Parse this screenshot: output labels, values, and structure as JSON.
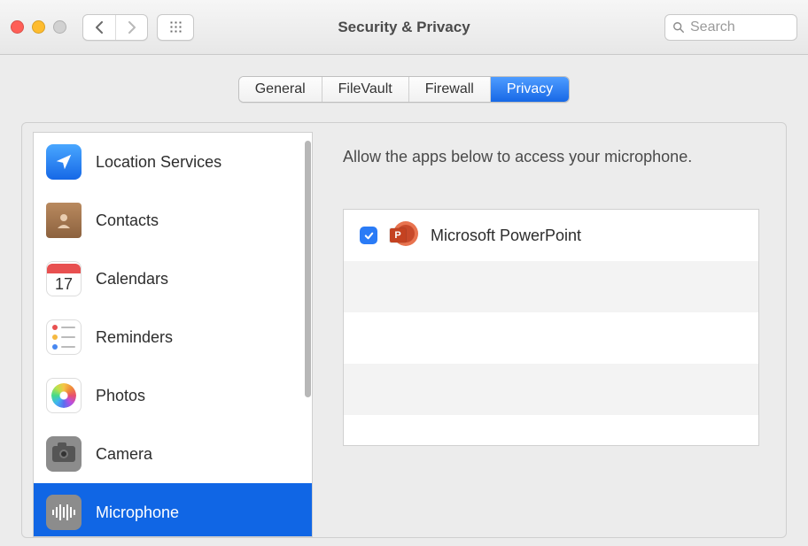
{
  "window": {
    "title": "Security & Privacy"
  },
  "search": {
    "placeholder": "Search"
  },
  "tabs": [
    {
      "label": "General",
      "selected": false
    },
    {
      "label": "FileVault",
      "selected": false
    },
    {
      "label": "Firewall",
      "selected": false
    },
    {
      "label": "Privacy",
      "selected": true
    }
  ],
  "sidebar": {
    "items": [
      {
        "id": "location",
        "label": "Location Services",
        "selected": false
      },
      {
        "id": "contacts",
        "label": "Contacts",
        "selected": false
      },
      {
        "id": "calendars",
        "label": "Calendars",
        "selected": false,
        "day": "17"
      },
      {
        "id": "reminders",
        "label": "Reminders",
        "selected": false
      },
      {
        "id": "photos",
        "label": "Photos",
        "selected": false
      },
      {
        "id": "camera",
        "label": "Camera",
        "selected": false
      },
      {
        "id": "microphone",
        "label": "Microphone",
        "selected": true
      }
    ]
  },
  "main": {
    "description": "Allow the apps below to access your microphone.",
    "apps": [
      {
        "name": "Microsoft PowerPoint",
        "checked": true,
        "badge": "P"
      }
    ]
  }
}
